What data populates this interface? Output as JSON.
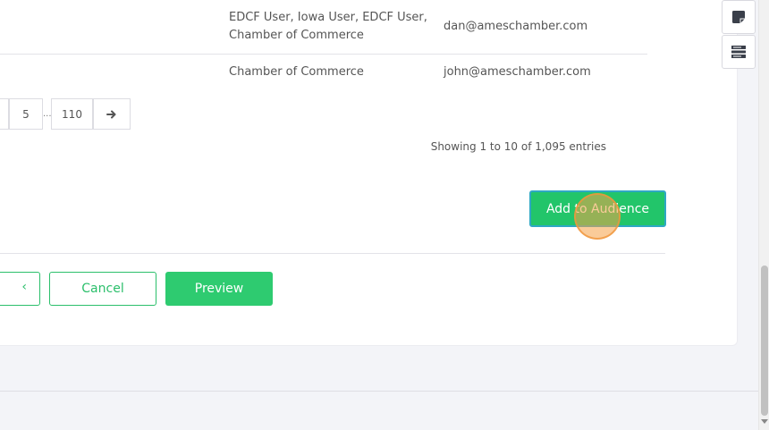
{
  "table": {
    "rows": [
      {
        "groups": "EDCF User, Iowa User, EDCF User, Chamber of Commerce",
        "email": "dan@ameschamber.com"
      },
      {
        "groups": "Chamber of Commerce",
        "email": "john@ameschamber.com"
      }
    ]
  },
  "pagination": {
    "pages": [
      "5",
      "110"
    ],
    "ellipsis": "...",
    "next_icon": "arrow-right-icon"
  },
  "summary": {
    "showing_text": "Showing 1 to 10 of 1,095 entries"
  },
  "actions": {
    "add_to_audience_label": "Add to Audience",
    "cancel_label": "Cancel",
    "preview_label": "Preview",
    "partial_button_label": "‹"
  },
  "side_toolbar": {
    "icons": [
      "note-icon",
      "list-icon"
    ]
  },
  "colors": {
    "primary_green": "#22c56a",
    "focus_border": "#2ea8c4",
    "click_indicator": "#f5a046"
  }
}
